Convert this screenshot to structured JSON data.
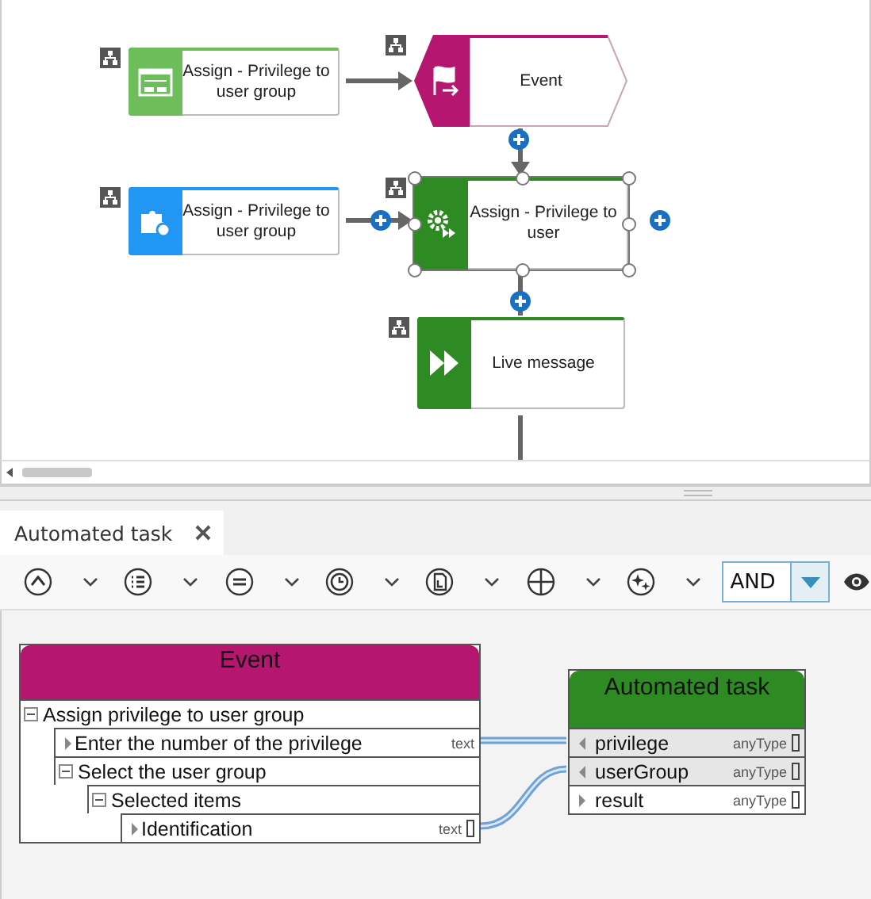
{
  "diagram": {
    "nodes": [
      {
        "kind": "screen",
        "text": "Assign - Privilege to user group",
        "color": "#6dbd5a",
        "selected": false
      },
      {
        "kind": "event",
        "text": "Event",
        "color": "#b5166f",
        "selected": false
      },
      {
        "kind": "integration",
        "text": "Assign - Privilege to user group",
        "color": "#2196f3",
        "selected": false
      },
      {
        "kind": "automated",
        "text": "Assign - Privilege to user",
        "color": "#2e8b24",
        "selected": true
      },
      {
        "kind": "message",
        "text": "Live message",
        "color": "#2e8b24",
        "selected": false
      }
    ]
  },
  "tabs": [
    {
      "label": "Automated task",
      "selected": true,
      "closable": true
    }
  ],
  "toolbar": {
    "combo": {
      "value": "AND"
    }
  },
  "mapping": {
    "source": {
      "title": "Event",
      "color": "#b5166f",
      "rows": [
        {
          "name": "Assign privilege to user group",
          "expanded": true,
          "children": [
            {
              "name": "Enter the number of the privilege",
              "type": "text",
              "list": false,
              "mapped": true
            },
            {
              "name": "Select the user group",
              "expanded": true,
              "children": [
                {
                  "name": "Selected items",
                  "expanded": true,
                  "children": [
                    {
                      "name": "Identification",
                      "type": "text",
                      "list": true,
                      "mapped": true
                    }
                  ]
                }
              ]
            }
          ]
        }
      ]
    },
    "target": {
      "title": "Automated task",
      "color": "#2e8b24",
      "rows": [
        {
          "name": "privilege",
          "type": "anyType",
          "kind": "input",
          "list": true,
          "mapped": true
        },
        {
          "name": "userGroup",
          "type": "anyType",
          "kind": "input",
          "list": true,
          "mapped": true
        },
        {
          "name": "result",
          "type": "anyType",
          "kind": "output",
          "list": true,
          "mapped": false
        }
      ]
    }
  }
}
